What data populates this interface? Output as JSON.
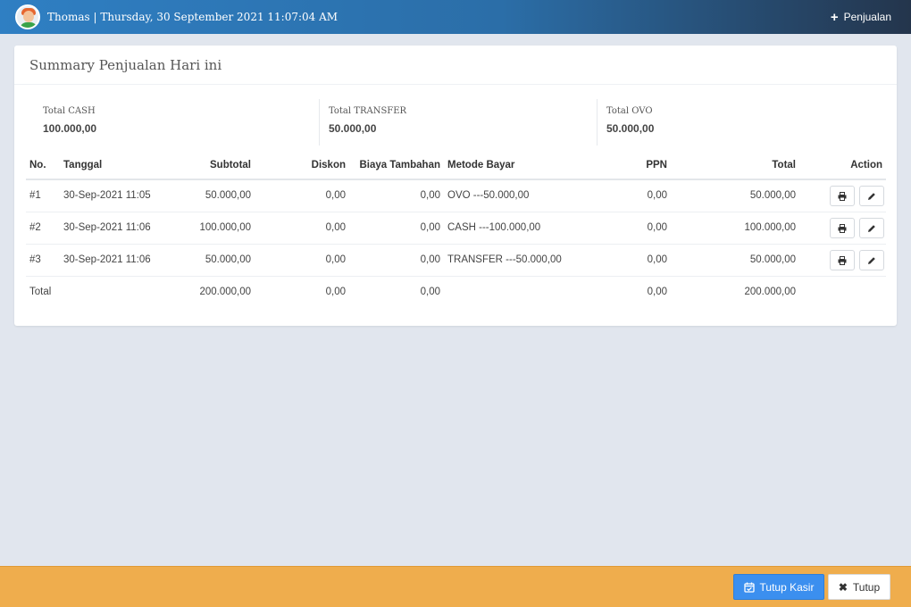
{
  "header": {
    "user_info": "Thomas | Thursday, 30 September 2021 11:07:04 AM",
    "nav_button": "Penjualan",
    "avatar_icon": "user-avatar-icon",
    "plus_icon": "plus-icon",
    "gradient_colors": [
      "#2f7fc3",
      "#24354c"
    ]
  },
  "panel": {
    "title": "Summary Penjualan Hari ini",
    "stats": [
      {
        "label": "Total CASH",
        "value": "100.000,00"
      },
      {
        "label": "Total TRANSFER",
        "value": "50.000,00"
      },
      {
        "label": "Total OVO",
        "value": "50.000,00"
      }
    ]
  },
  "table": {
    "headers": {
      "no": "No.",
      "tanggal": "Tanggal",
      "subtotal": "Subtotal",
      "diskon": "Diskon",
      "biaya_tambahan": "Biaya Tambahan",
      "metode_bayar": "Metode Bayar",
      "ppn": "PPN",
      "total": "Total",
      "action": "Action"
    },
    "rows": [
      {
        "no": "#1",
        "tanggal": "30-Sep-2021 11:05",
        "subtotal": "50.000,00",
        "diskon": "0,00",
        "biaya_tambahan": "0,00",
        "metode_bayar": "OVO ---50.000,00",
        "ppn": "0,00",
        "total": "50.000,00"
      },
      {
        "no": "#2",
        "tanggal": "30-Sep-2021 11:06",
        "subtotal": "100.000,00",
        "diskon": "0,00",
        "biaya_tambahan": "0,00",
        "metode_bayar": "CASH ---100.000,00",
        "ppn": "0,00",
        "total": "100.000,00"
      },
      {
        "no": "#3",
        "tanggal": "30-Sep-2021 11:06",
        "subtotal": "50.000,00",
        "diskon": "0,00",
        "biaya_tambahan": "0,00",
        "metode_bayar": "TRANSFER ---50.000,00",
        "ppn": "0,00",
        "total": "50.000,00"
      }
    ],
    "totals": {
      "label": "Total",
      "subtotal": "200.000,00",
      "diskon": "0,00",
      "biaya_tambahan": "0,00",
      "ppn": "0,00",
      "total": "200.000,00"
    },
    "row_action_icons": [
      "print-icon",
      "edit-icon"
    ]
  },
  "footer": {
    "tutup_kasir_label": "Tutup Kasir",
    "tutup_label": "Tutup",
    "tutup_kasir_icon": "calendar-check-icon",
    "tutup_icon": "close-icon",
    "background_color": "#efad4d",
    "primary_button_color": "#3b8fef"
  }
}
